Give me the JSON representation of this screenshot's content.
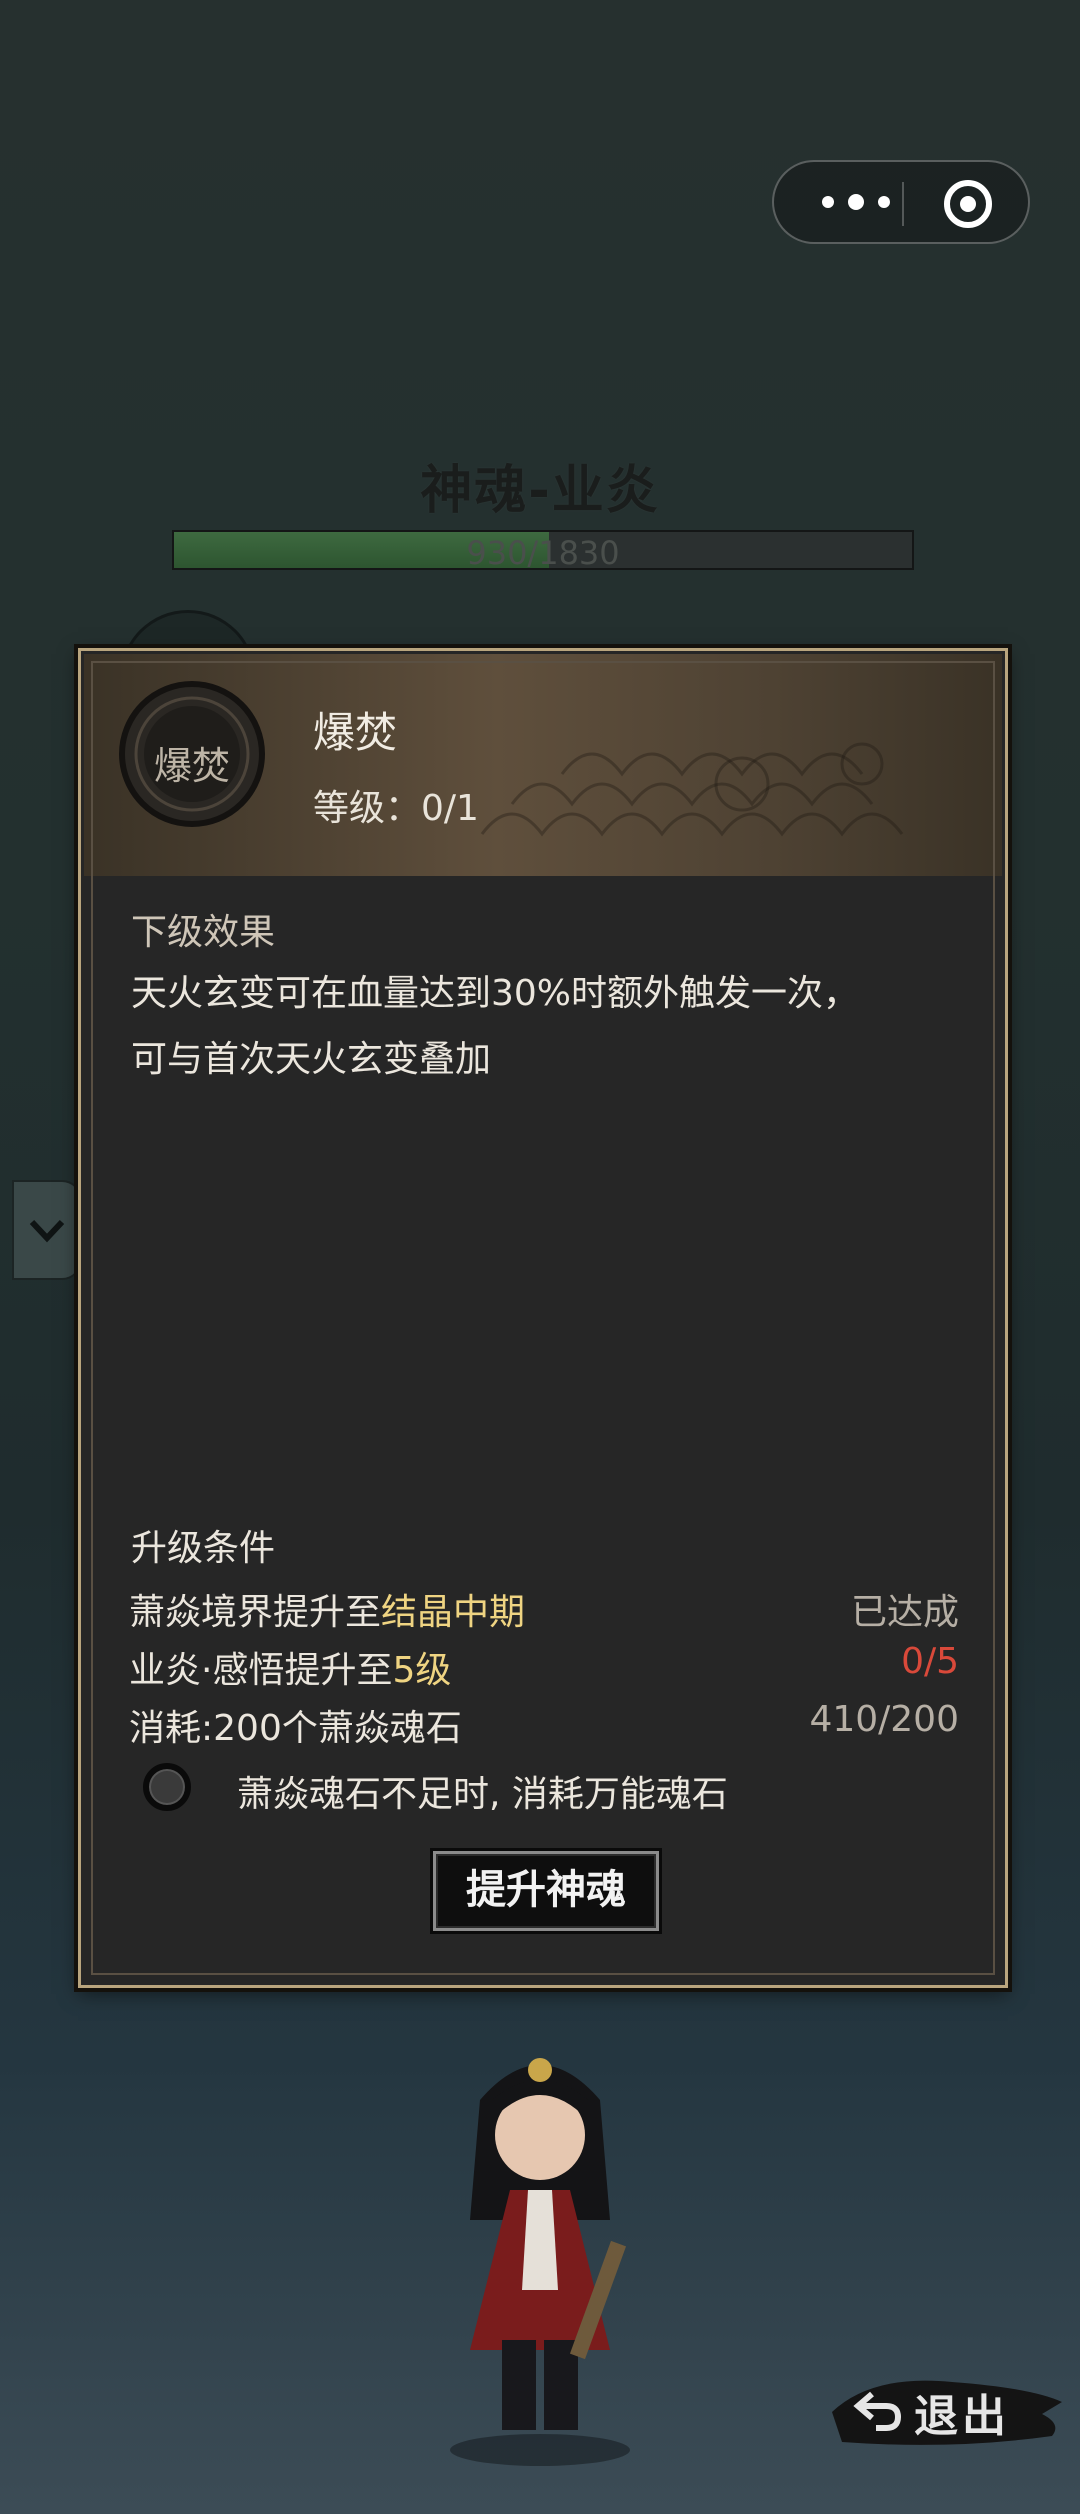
{
  "system": {
    "more_icon": "more-dots-icon",
    "close_icon": "target-close-icon"
  },
  "page": {
    "title": "神魂-业炎",
    "progress_text": "930/1830",
    "progress_value": 930,
    "progress_max": 1830
  },
  "panel": {
    "skill": {
      "icon_label": "爆焚",
      "name": "爆焚",
      "level_text": "等级：0/1"
    },
    "effect_heading": "下级效果",
    "effect_lines": [
      "天火玄变可在血量达到30%时额外触发一次，",
      "可与首次天火玄变叠加"
    ],
    "conditions_heading": "升级条件",
    "conditions": [
      {
        "prefix": "萧焱境界提升至",
        "highlight": "结晶中期",
        "status": "已达成",
        "status_type": "ok"
      },
      {
        "prefix": "业炎·感悟提升至",
        "highlight": "5级",
        "status": "0/5",
        "status_type": "bad"
      },
      {
        "prefix": "消耗:200个萧焱魂石",
        "highlight": "",
        "status": "410/200",
        "status_type": "progress"
      }
    ],
    "toggle_label": "萧焱魂石不足时, 消耗万能魂石",
    "upgrade_button": "提升神魂"
  },
  "footer": {
    "exit_label": "退出"
  },
  "colors": {
    "highlight": "#efd482",
    "fail": "#d9493a",
    "panel_border": "#b9a57e",
    "progress_fill": "#3e6a40"
  }
}
